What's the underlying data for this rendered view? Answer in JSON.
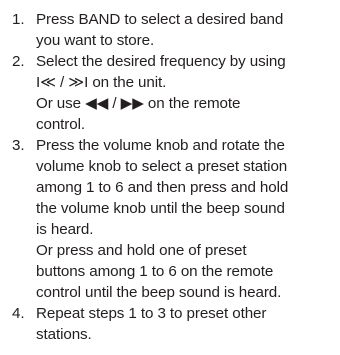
{
  "steps": [
    {
      "number": "1.",
      "lines": [
        "Press BAND to select a desired band",
        "you want to store."
      ]
    },
    {
      "number": "2.",
      "lines": [
        "Select the desired frequency by using",
        "I≪ / ≫I on the unit.",
        "Or use ◀◀ / ▶▶ on the remote",
        "control."
      ]
    },
    {
      "number": "3.",
      "lines": [
        "Press the volume knob and rotate the",
        "volume knob to select a preset station",
        "among 1 to 6 and then press and hold",
        "the volume knob until the beep sound",
        "is heard.",
        "Or press and hold one of preset",
        "buttons among 1 to 6 on the remote",
        "control until the beep sound is heard."
      ]
    },
    {
      "number": "4.",
      "lines": [
        "Repeat steps 1 to 3 to preset other",
        "stations."
      ]
    }
  ]
}
